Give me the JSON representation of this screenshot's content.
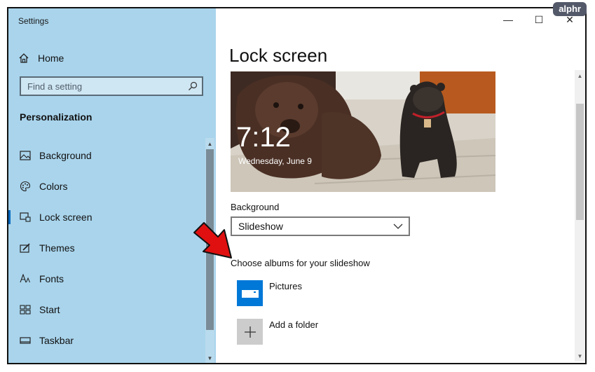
{
  "window": {
    "app_title": "Settings",
    "controls": {
      "minimize": "—",
      "maximize": "☐",
      "close": "✕"
    }
  },
  "watermark": "alphr",
  "sidebar": {
    "home_label": "Home",
    "search": {
      "placeholder": "Find a setting"
    },
    "section_title": "Personalization",
    "items": [
      {
        "label": "Background",
        "icon": "picture-icon"
      },
      {
        "label": "Colors",
        "icon": "palette-icon"
      },
      {
        "label": "Lock screen",
        "icon": "lock-screen-icon",
        "active": true
      },
      {
        "label": "Themes",
        "icon": "brush-icon"
      },
      {
        "label": "Fonts",
        "icon": "font-icon"
      },
      {
        "label": "Start",
        "icon": "start-icon"
      },
      {
        "label": "Taskbar",
        "icon": "taskbar-icon"
      }
    ]
  },
  "main": {
    "page_title": "Lock screen",
    "preview": {
      "time": "7:12",
      "date": "Wednesday, June 9"
    },
    "background_label": "Background",
    "background_value": "Slideshow",
    "albums_label": "Choose albums for your slideshow",
    "albums": [
      {
        "label": "Pictures",
        "icon": "folder-icon"
      },
      {
        "label": "Add a folder",
        "icon": "plus-icon"
      }
    ]
  },
  "colors": {
    "sidebar_bg": "#a9d4ec",
    "accent": "#0067c0",
    "arrow": "#e01010"
  }
}
